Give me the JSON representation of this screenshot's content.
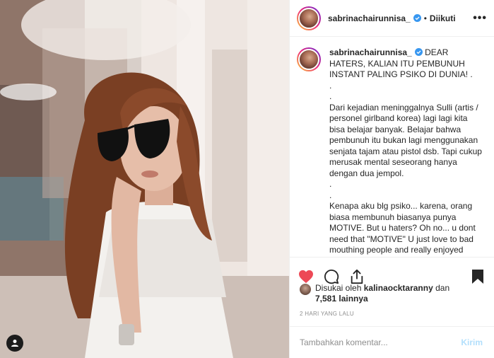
{
  "post": {
    "username": "sabrinachairunnisa_",
    "follow_status": "Diikuti",
    "separator": "•",
    "more_label": "•••",
    "verified": true,
    "accent_color": "#3897f0",
    "like_color": "#ed4956"
  },
  "caption": {
    "username": "sabrinachairunnisa_",
    "lines": [
      "DEAR HATERS, KALIAN ITU PEMBUNUH INSTANT PALING PSIKO DI DUNIA! .",
      ".",
      ".",
      "Dari kejadian meninggalnya Sulli (artis / personel girlband korea) lagi lagi kita bisa belajar banyak. Belajar bahwa pembunuh itu bukan lagi menggunakan senjata tajam atau pistol dsb. Tapi cukup merusak mental seseorang hanya dengan dua jempol.",
      ".",
      ".",
      "Kenapa aku blg psiko... karena, orang biasa membunuh biasanya punya MOTIVE. But u haters? Oh no... u dont need that \"MOTIVE\" U just love to bad mouthing people and really enjoyed"
    ]
  },
  "actions": {
    "like_icon": "heart-filled-icon",
    "comment_icon": "comment-icon",
    "share_icon": "share-icon",
    "save_icon": "bookmark-filled-icon"
  },
  "likes": {
    "prefix": "Disukai oleh",
    "first_liker": "kalinaocktaranny",
    "and": "dan",
    "others": "7,581 lainnya"
  },
  "timestamp": "2 HARI YANG LALU",
  "comment": {
    "placeholder": "Tambahkan komentar...",
    "send_label": "Kirim"
  }
}
